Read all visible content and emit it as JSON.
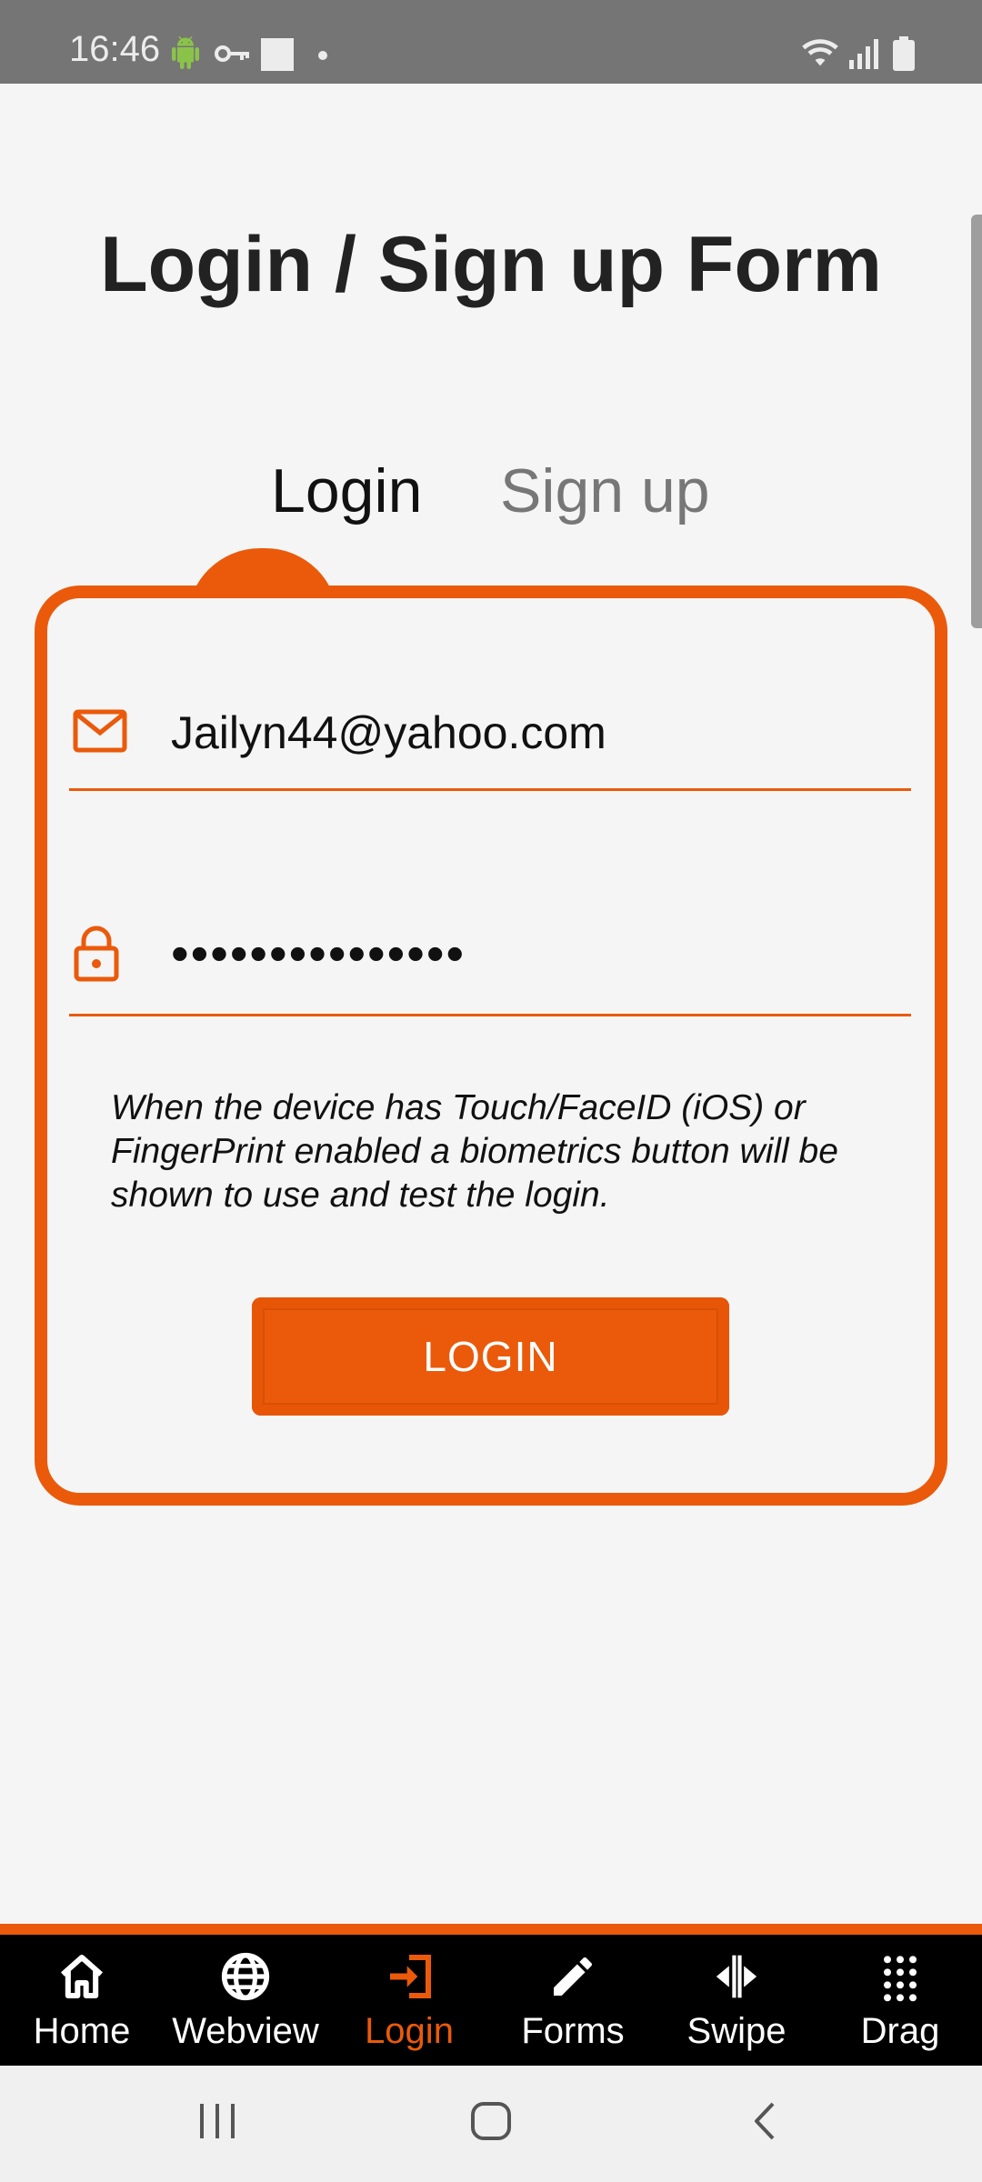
{
  "status_bar": {
    "time": "16:46"
  },
  "page": {
    "title": "Login / Sign up Form"
  },
  "tabs": [
    {
      "label": "Login",
      "active": true
    },
    {
      "label": "Sign up",
      "active": false
    }
  ],
  "form": {
    "email": {
      "value": "Jailyn44@yahoo.com",
      "icon": "mail-icon"
    },
    "password": {
      "value": "•••••••••••••••",
      "icon": "lock-icon"
    },
    "help_text": "When the device has Touch/FaceID (iOS) or FingerPrint enabled a biometrics button will be shown to use and test the login.",
    "login_button": "LOGIN"
  },
  "bottom_nav": {
    "items": [
      {
        "label": "Home",
        "icon": "home-icon",
        "active": false
      },
      {
        "label": "Webview",
        "icon": "globe-icon",
        "active": false
      },
      {
        "label": "Login",
        "icon": "login-icon",
        "active": true
      },
      {
        "label": "Forms",
        "icon": "pencil-icon",
        "active": false
      },
      {
        "label": "Swipe",
        "icon": "swipe-icon",
        "active": false
      },
      {
        "label": "Drag",
        "icon": "grid-icon",
        "active": false
      }
    ]
  },
  "colors": {
    "accent": "#ea5a0a",
    "status_bar": "#757575",
    "nav_background": "#000000",
    "page_background": "#f5f5f5"
  }
}
